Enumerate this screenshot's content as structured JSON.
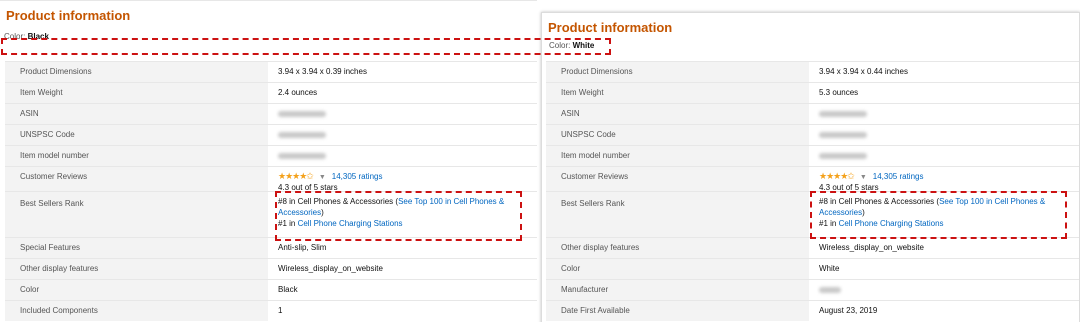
{
  "left": {
    "title": "Product information",
    "color_label": "Color:",
    "color_value": "Black",
    "rows": {
      "dimensions": {
        "label": "Product Dimensions",
        "value": "3.94 x 3.94 x 0.39 inches"
      },
      "weight": {
        "label": "Item Weight",
        "value": "2.4 ounces"
      },
      "asin": {
        "label": "ASIN"
      },
      "unspsc": {
        "label": "UNSPSC Code"
      },
      "model": {
        "label": "Item model number"
      },
      "reviews": {
        "label": "Customer Reviews",
        "stars": "★★★★✩",
        "rating_count": "14,305 ratings",
        "rating_text": "4.3 out of 5 stars"
      },
      "bsr": {
        "label": "Best Sellers Rank",
        "rank1": "#8 in Cell Phones & Accessories (",
        "rank1_link": "See Top 100 in Cell Phones & Accessories",
        "rank1_end": ")",
        "rank2": "#1 in ",
        "rank2_link": "Cell Phone Charging Stations"
      },
      "special": {
        "label": "Special Features",
        "value": "Anti-slip, Slim"
      },
      "other_display": {
        "label": "Other display features",
        "value": "Wireless_display_on_website"
      },
      "color": {
        "label": "Color",
        "value": "Black"
      },
      "components": {
        "label": "Included Components",
        "value": "1"
      }
    }
  },
  "right": {
    "title": "Product information",
    "color_label": "Color:",
    "color_value": "White",
    "rows": {
      "dimensions": {
        "label": "Product Dimensions",
        "value": "3.94 x 3.94 x 0.44 inches"
      },
      "weight": {
        "label": "Item Weight",
        "value": "5.3 ounces"
      },
      "asin": {
        "label": "ASIN"
      },
      "unspsc": {
        "label": "UNSPSC Code"
      },
      "model": {
        "label": "Item model number"
      },
      "reviews": {
        "label": "Customer Reviews",
        "stars": "★★★★✩",
        "rating_count": "14,305 ratings",
        "rating_text": "4.3 out of 5 stars"
      },
      "bsr": {
        "label": "Best Sellers Rank",
        "rank1": "#8 in Cell Phones & Accessories (",
        "rank1_link": "See Top 100 in Cell Phones & Accessories",
        "rank1_end": ")",
        "rank2": "#1 in ",
        "rank2_link": "Cell Phone Charging Stations"
      },
      "other_display": {
        "label": "Other display features",
        "value": "Wireless_display_on_website"
      },
      "color": {
        "label": "Color",
        "value": "White"
      },
      "manufacturer": {
        "label": "Manufacturer"
      },
      "date_first": {
        "label": "Date First Available",
        "value": "August 23, 2019"
      }
    }
  },
  "colors": {
    "title": "#c45500",
    "link": "#0066c0",
    "star": "#f4a11b",
    "highlight": "#cc1111"
  },
  "icons": {
    "chevron": "chevron-down-icon",
    "stars": "star-rating-icon"
  }
}
